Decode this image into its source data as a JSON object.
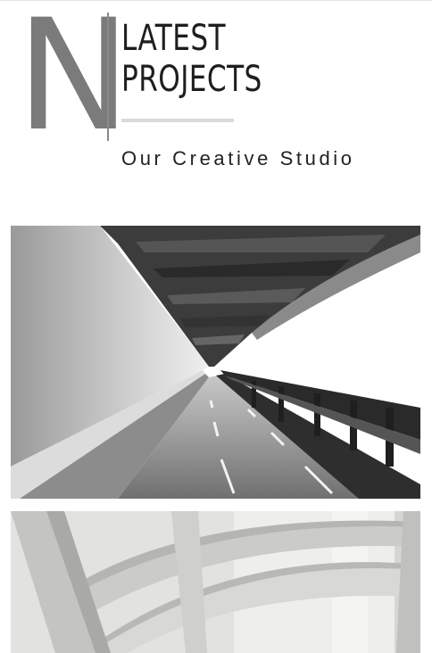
{
  "header": {
    "logo_letter": "N",
    "title_line1": "LATEST",
    "title_line2": "PROJECTS",
    "subtitle": "Our Creative Studio"
  },
  "gallery": {
    "items": [
      {
        "subject": "bridge-walkway-photo"
      },
      {
        "subject": "spiral-concrete-ramp-photo"
      }
    ]
  }
}
